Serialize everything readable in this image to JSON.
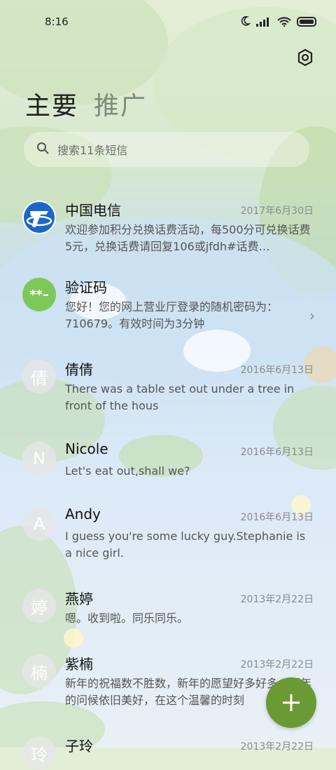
{
  "status": {
    "time": "8:16"
  },
  "tabs": [
    {
      "label": "主要"
    },
    {
      "label": "推广"
    }
  ],
  "search": {
    "placeholder": "搜索11条短信"
  },
  "messages": [
    {
      "name": "中国电信",
      "date": "2017年6月30日",
      "preview": "欢迎参加积分兑换话费活动，每500分可兑换话费5元，兑换话费请回复106或jfdh#话费…",
      "avatar": "telecom"
    },
    {
      "name": "验证码",
      "date": "",
      "preview": "您好！您的网上营业厅登录的随机密码为：710679。有效时间为3分钟",
      "avatar_text": "**–"
    },
    {
      "name": "倩倩",
      "date": "2016年6月13日",
      "preview": "There was a table set out under a tree in front of the hous",
      "avatar_text": "倩"
    },
    {
      "name": "Nicole",
      "date": "2016年6月13日",
      "preview": "Let's eat out,shall we?",
      "avatar_text": "N"
    },
    {
      "name": "Andy",
      "date": "2016年6月13日",
      "preview": "I guess you're some lucky guy.Stephanie is a nice girl.",
      "avatar_text": "A"
    },
    {
      "name": "燕婷",
      "date": "2013年2月22日",
      "preview": "嗯。收到啦。同乐同乐。",
      "avatar_text": "婷"
    },
    {
      "name": "紫楠",
      "date": "2013年2月22日",
      "preview": "新年的祝福数不胜数，新年的愿望好多好多，新年的问候依旧美好，在这个温馨的时刻",
      "avatar_text": "楠"
    },
    {
      "name": "子玲",
      "date": "2013年2月22日",
      "preview": "",
      "avatar_text": "玲"
    }
  ],
  "colors": {
    "fab": "#6b9a34",
    "verify_avatar": "#7ec85a",
    "telecom_blue": "#1b67c9"
  }
}
